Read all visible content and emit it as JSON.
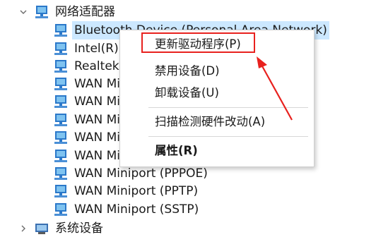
{
  "tree": {
    "category_network": {
      "label": "网络适配器",
      "expanded": true,
      "icon": "network-adapters-category-icon"
    },
    "children": [
      {
        "label": "Bluetooth Device (Personal Area Network)",
        "selected": true
      },
      {
        "label": "Intel(R) Wireless-AC 9560 160MHz"
      },
      {
        "label": "Realtek PCIe GbE Family Controller"
      },
      {
        "label": "WAN Miniport (IKEv2)"
      },
      {
        "label": "WAN Miniport (IP)"
      },
      {
        "label": "WAN Miniport (IPv6)"
      },
      {
        "label": "WAN Miniport (L2TP)"
      },
      {
        "label": "WAN Miniport (Network Monitor)"
      },
      {
        "label": "WAN Miniport (PPPOE)"
      },
      {
        "label": "WAN Miniport (PPTP)"
      },
      {
        "label": "WAN Miniport (SSTP)"
      }
    ],
    "category_system": {
      "label": "系统设备",
      "expanded": false,
      "icon": "system-devices-category-icon"
    }
  },
  "context_menu": {
    "update_driver": "更新驱动程序(P)",
    "disable_device": "禁用设备(D)",
    "uninstall_device": "卸载设备(U)",
    "scan_hardware": "扫描检测硬件改动(A)",
    "properties": "属性(R)"
  },
  "annotation": {
    "color": "#e8211e",
    "target": "update_driver"
  },
  "colors": {
    "selection": "#cce8ff",
    "icon_blue": "#2b78c9",
    "icon_screen": "#7fc3f0"
  }
}
